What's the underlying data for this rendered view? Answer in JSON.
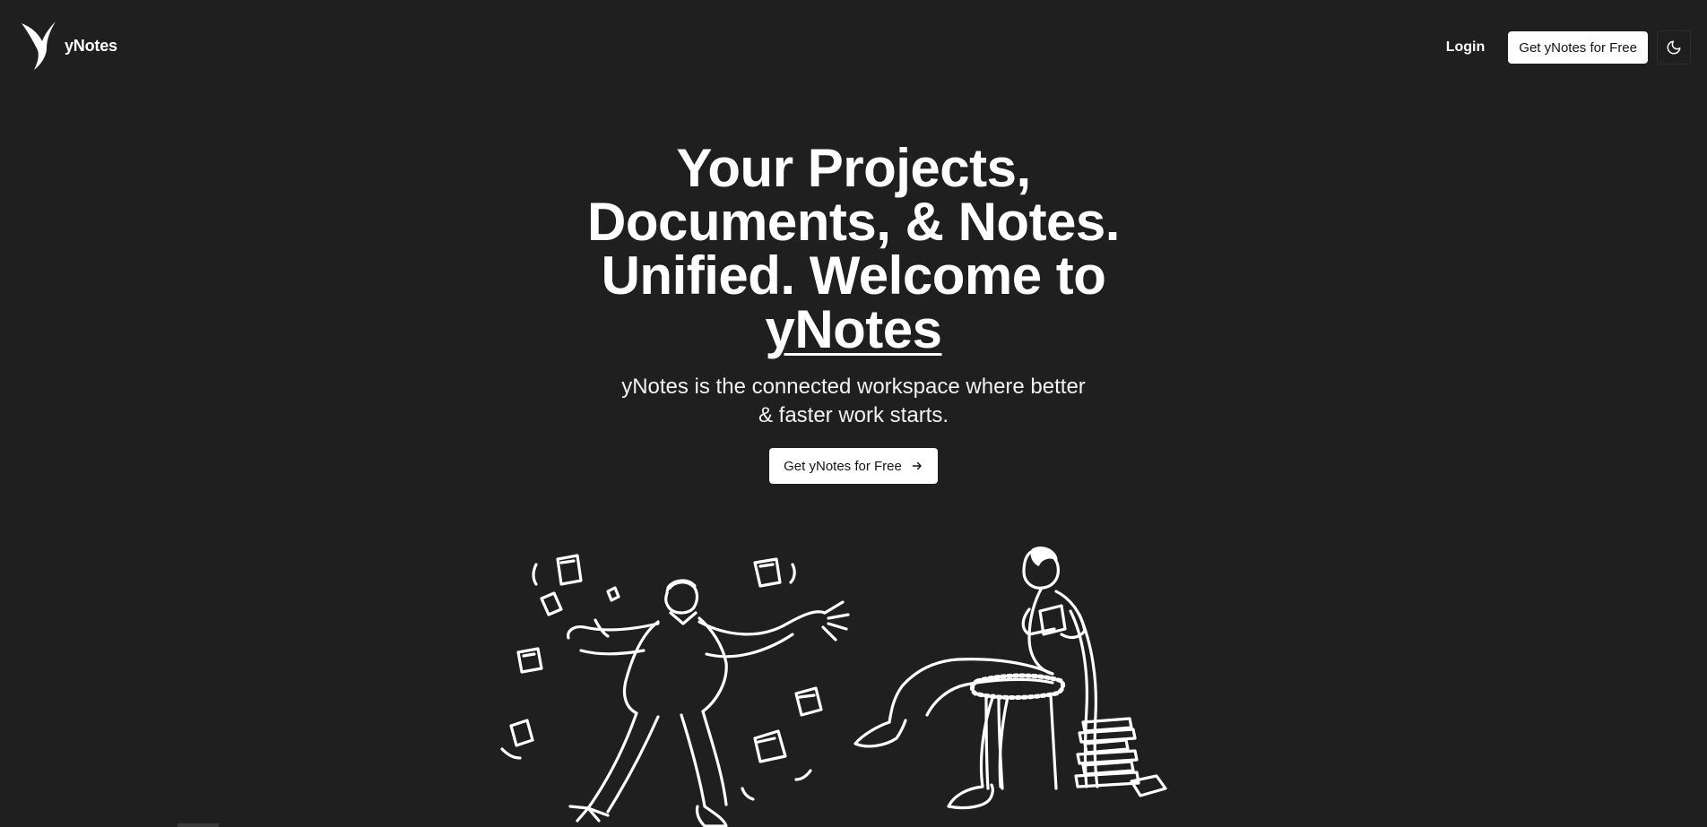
{
  "brand": {
    "name": "yNotes",
    "logo_icon": "y-logo-icon"
  },
  "nav": {
    "login_label": "Login",
    "cta_label": "Get yNotes for Free",
    "theme_icon": "moon-icon"
  },
  "hero": {
    "title_line1": "Your Projects,",
    "title_line2": "Documents, & Notes.",
    "title_line3": "Unified. Welcome to",
    "title_brand": "yNotes",
    "subtitle": "yNotes is the connected workspace where better & faster work starts.",
    "cta_label": "Get yNotes for Free",
    "cta_icon": "arrow-right-icon"
  },
  "illustration": {
    "left_figure": "man-juggling-papers-illustration",
    "right_figure": "woman-reading-in-chair-illustration"
  },
  "colors": {
    "background": "#1f1f1f",
    "text": "#ffffff",
    "button_bg": "#ffffff",
    "button_text": "#141414"
  }
}
